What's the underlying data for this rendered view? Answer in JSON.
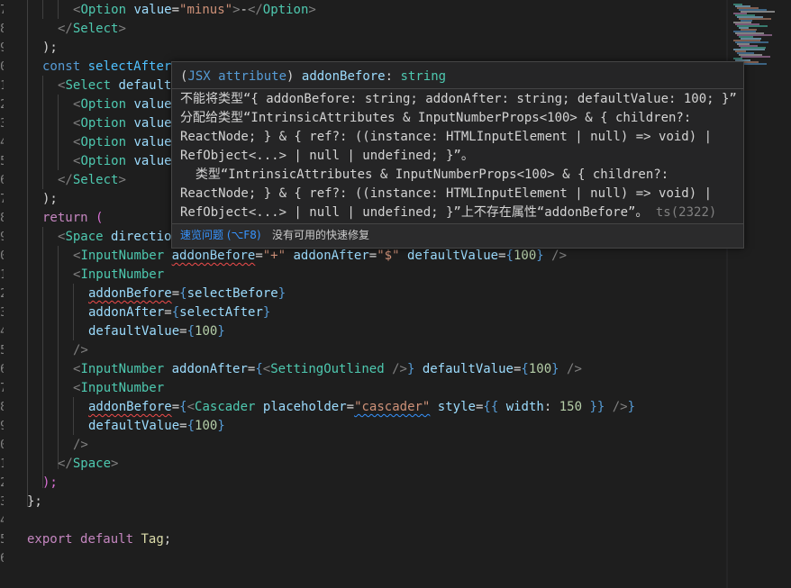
{
  "gutter": {
    "line_digits": [
      "7",
      "8",
      "9",
      "0",
      "1",
      "2",
      "3",
      "4",
      "5",
      "6",
      "7",
      "8",
      "9",
      "0",
      "1",
      "2",
      "3",
      "4",
      "5",
      "6",
      "7",
      "8",
      "9",
      "0",
      "1",
      "2",
      "3",
      "4",
      "5",
      "6"
    ]
  },
  "code": {
    "l0": {
      "a": "<",
      "b": "Option",
      "c": "value",
      "d": "=",
      "e": "\"minus\"",
      "f": ">",
      "g": "-",
      "h": "</",
      "i": "Option",
      "j": ">"
    },
    "l1": {
      "a": "</",
      "b": "Select",
      "c": ">"
    },
    "l2": {
      "a": ");"
    },
    "l3": {
      "a": "const",
      "b": "selectAfter"
    },
    "l4": {
      "a": "<",
      "b": "Select",
      "c": "default"
    },
    "l5": {
      "a": "<",
      "b": "Option",
      "c": "value"
    },
    "l6": {
      "a": "<",
      "b": "Option",
      "c": "value"
    },
    "l7": {
      "a": "<",
      "b": "Option",
      "c": "value"
    },
    "l8": {
      "a": "<",
      "b": "Option",
      "c": "value"
    },
    "l9": {
      "a": "</",
      "b": "Select",
      "c": ">"
    },
    "l10": {
      "a": ");"
    },
    "l11": {
      "a": "return",
      "b": "("
    },
    "l12": {
      "a": "<",
      "b": "Space",
      "c": "directio"
    },
    "l13": {
      "a": "<",
      "b": "InputNumber",
      "c": "addonBefore",
      "d": "=",
      "e": "\"+\"",
      "f": "addonAfter",
      "g": "=",
      "h": "\"$\"",
      "i": "defaultValue",
      "j": "=",
      "k": "{",
      "l": "100",
      "m": "}",
      "n": "/>"
    },
    "l14": {
      "a": "<",
      "b": "InputNumber"
    },
    "l15": {
      "a": "addonBefore",
      "b": "=",
      "c": "{",
      "d": "selectBefore",
      "e": "}"
    },
    "l16": {
      "a": "addonAfter",
      "b": "=",
      "c": "{",
      "d": "selectAfter",
      "e": "}"
    },
    "l17": {
      "a": "defaultValue",
      "b": "=",
      "c": "{",
      "d": "100",
      "e": "}"
    },
    "l18": {
      "a": "/>"
    },
    "l19": {
      "a": "<",
      "b": "InputNumber",
      "c": "addonAfter",
      "d": "=",
      "e": "{",
      "f": "<",
      "g": "SettingOutlined",
      "h": "/>",
      "i": "}",
      "j": "defaultValue",
      "k": "=",
      "l": "{",
      "m": "100",
      "n": "}",
      "o": "/>"
    },
    "l20": {
      "a": "<",
      "b": "InputNumber"
    },
    "l21": {
      "a": "addonBefore",
      "b": "=",
      "c": "{",
      "d": "<",
      "e": "Cascader",
      "f": "placeholder",
      "g": "=",
      "h": "\"cascader\"",
      "i": "style",
      "j": "=",
      "k": "{{",
      "l": "width",
      "m": ":",
      "n": "150",
      "o": "}}",
      "p": "/>",
      "q": "}"
    },
    "l22": {
      "a": "defaultValue",
      "b": "=",
      "c": "{",
      "d": "100",
      "e": "}"
    },
    "l23": {
      "a": "/>"
    },
    "l24": {
      "a": "</",
      "b": "Space",
      "c": ">"
    },
    "l25": {
      "a": ");"
    },
    "l26": {
      "a": "};"
    },
    "l27": {},
    "l28": {
      "a": "export",
      "b": "default",
      "c": "Tag",
      "d": ";"
    },
    "l29": {}
  },
  "hover": {
    "sig_open": "(",
    "sig_jsx": "JSX attribute",
    "sig_close": ")",
    "sig_name": "addonBefore",
    "sig_colon": ":",
    "sig_type": "string",
    "message": "不能将类型“{ addonBefore: string; addonAfter: string; defaultValue: 100; }”\n分配给类型“IntrinsicAttributes & InputNumberProps<100> & { children?:\nReactNode; } & { ref?: ((instance: HTMLInputElement | null) => void) |\nRefObject<...> | null | undefined; }”。\n  类型“IntrinsicAttributes & InputNumberProps<100> & { children?:\nReactNode; } & { ref?: ((instance: HTMLInputElement | null) => void) |\nRefObject<...> | null | undefined; }”上不存在属性“addonBefore”。",
    "code": "ts(2322)",
    "quick_peek": "速览问题 (⌥F8)",
    "no_fix": "没有可用的快速修复"
  },
  "colors": {
    "background": "#1e1e1e",
    "hover_bg": "#252526",
    "error_squiggle": "#f14c4c",
    "link": "#3794ff"
  }
}
